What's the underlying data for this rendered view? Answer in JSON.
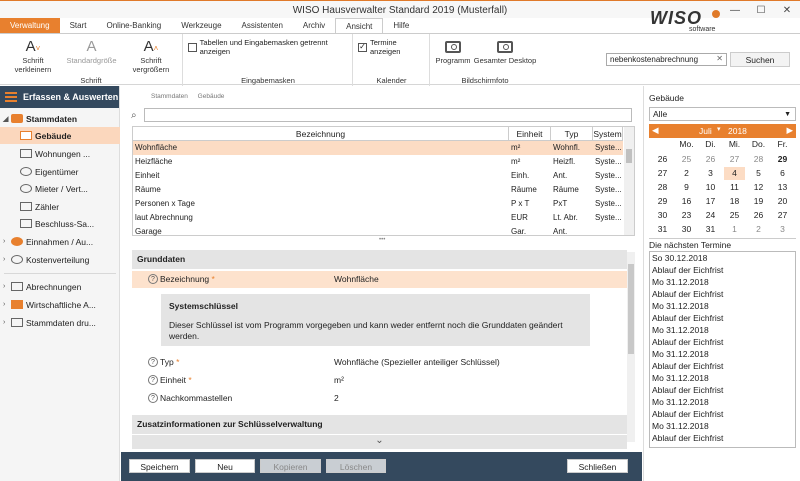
{
  "window": {
    "title": "WISO Hausverwalter Standard 2019 (Musterfall)",
    "controls": [
      "—",
      "☐",
      "✕"
    ]
  },
  "logo": {
    "brand": "WISO",
    "sub": "software"
  },
  "tabs": [
    "Verwaltung",
    "Start",
    "Online-Banking",
    "Werkzeuge",
    "Assistenten",
    "Archiv",
    "Ansicht",
    "Hilfe"
  ],
  "active_tab": "Ansicht",
  "ribbon": {
    "schrift": {
      "group": "Schrift",
      "smaller": "Schrift verkleinern",
      "standard": "Standardgröße",
      "bigger": "Schrift vergrößern"
    },
    "eingabemasken": {
      "group": "Eingabemasken",
      "check_label": "Tabellen und Eingabemasken getrennt anzeigen"
    },
    "kalender": {
      "group": "Kalender",
      "check_label": "Termine anzeigen"
    },
    "bildschirmfoto": {
      "group": "Bildschirmfoto",
      "programm": "Programm",
      "desktop": "Gesamter Desktop"
    },
    "search_value": "nebenkostenabrechnung",
    "search_button": "Suchen"
  },
  "sidebar": {
    "header": "Erfassen & Auswerten",
    "items": [
      {
        "label": "Stammdaten",
        "arrow": "◢",
        "bold": true
      },
      {
        "label": "Gebäude",
        "selected": true
      },
      {
        "label": "Wohnungen ..."
      },
      {
        "label": "Eigentümer"
      },
      {
        "label": "Mieter / Vert..."
      },
      {
        "label": "Zähler"
      },
      {
        "label": "Beschluss-Sa..."
      },
      {
        "label": "Einnahmen / Au...",
        "arrow": "›"
      },
      {
        "label": "Kostenverteilung",
        "arrow": "›"
      },
      {
        "label": "Abrechnungen",
        "arrow": "›"
      },
      {
        "label": "Wirtschaftliche A...",
        "arrow": "›"
      },
      {
        "label": "Stammdaten dru...",
        "arrow": "›"
      }
    ]
  },
  "breadcrumb": [
    "Stammdaten",
    "Gebäude"
  ],
  "table": {
    "headers": [
      "Bezeichnung",
      "Einheit",
      "Typ",
      "System"
    ],
    "rows": [
      [
        "Wohnfläche",
        "m²",
        "Wohnfl.",
        "Syste..."
      ],
      [
        "Heizfläche",
        "m²",
        "Heizfl.",
        "Syste..."
      ],
      [
        "Einheit",
        "Einh.",
        "Ant.",
        "Syste..."
      ],
      [
        "Räume",
        "Räume",
        "Räume",
        "Syste..."
      ],
      [
        "Personen x Tage",
        "P x T",
        "PxT",
        "Syste..."
      ],
      [
        "laut Abrechnung",
        "EUR",
        "Lt. Abr.",
        "Syste..."
      ],
      [
        "Garage",
        "Gar.",
        "Ant.",
        ""
      ]
    ]
  },
  "details": {
    "grunddaten": "Grunddaten",
    "bezeichnung_label": "Bezeichnung",
    "bezeichnung_value": "Wohnfläche",
    "system_title": "Systemschlüssel",
    "system_text": "Dieser Schlüssel ist vom Programm vorgegeben und kann weder entfernt noch die Grunddaten geändert werden.",
    "typ_label": "Typ",
    "typ_value": "Wohnfläche (Spezieller anteiliger Schlüssel)",
    "einheit_label": "Einheit",
    "einheit_value": "m²",
    "nachkomma_label": "Nachkommastellen",
    "nachkomma_value": "2",
    "zusatz": "Zusatzinformationen zur Schlüsselverwaltung",
    "required_mark": "*"
  },
  "buttons": {
    "save": "Speichern",
    "new": "Neu",
    "copy": "Kopieren",
    "delete": "Löschen",
    "close": "Schließen"
  },
  "right": {
    "building_label": "Gebäude",
    "building_value": "Alle",
    "month": "Juli",
    "year": "2018",
    "weekdays": [
      "Mo.",
      "Di.",
      "Mi.",
      "Do.",
      "Fr."
    ],
    "weeks": [
      [
        "26",
        "25",
        "26",
        "27",
        "28",
        "29"
      ],
      [
        "27",
        "2",
        "3",
        "4",
        "5",
        "6"
      ],
      [
        "28",
        "9",
        "10",
        "11",
        "12",
        "13"
      ],
      [
        "29",
        "16",
        "17",
        "18",
        "19",
        "20"
      ],
      [
        "30",
        "23",
        "24",
        "25",
        "26",
        "27"
      ],
      [
        "31",
        "30",
        "31",
        "1",
        "2",
        "3"
      ]
    ],
    "termine_label": "Die nächsten Termine",
    "termine": [
      "So 30.12.2018",
      "Ablauf der Eichfrist",
      "Mo 31.12.2018",
      "Ablauf der Eichfrist",
      "Mo 31.12.2018",
      "Ablauf der Eichfrist",
      "Mo 31.12.2018",
      "Ablauf der Eichfrist",
      "Mo 31.12.2018",
      "Ablauf der Eichfrist",
      "Mo 31.12.2018",
      "Ablauf der Eichfrist",
      "Mo 31.12.2018",
      "Ablauf der Eichfrist",
      "Mo 31.12.2018",
      "Ablauf der Eichfrist"
    ]
  },
  "colors": {
    "accent": "#e8802e",
    "navy": "#34495e",
    "selection": "#fcdcc4"
  }
}
